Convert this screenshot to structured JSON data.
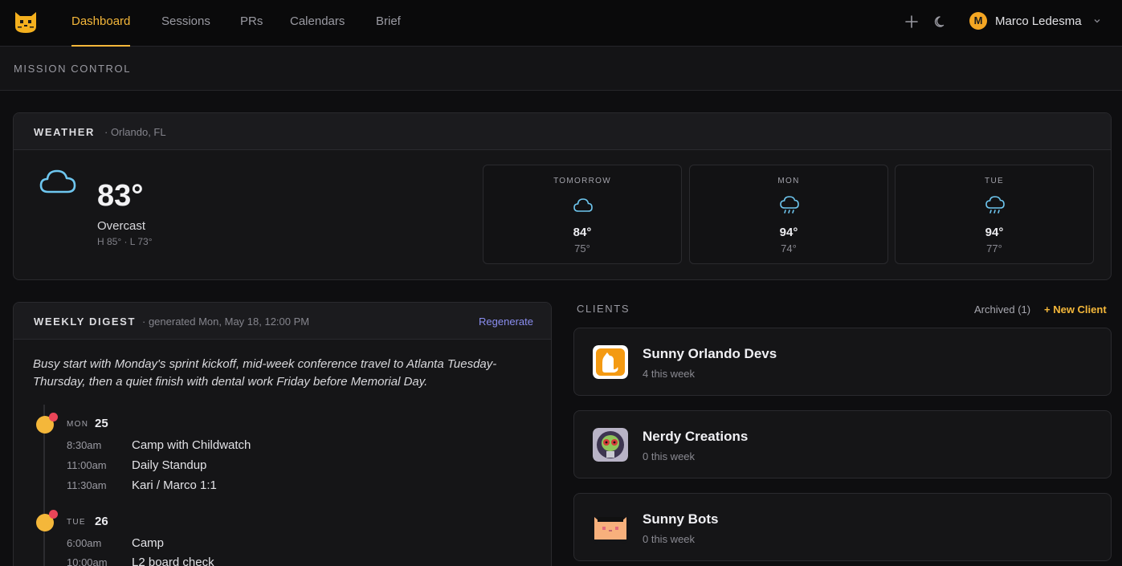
{
  "nav": {
    "tabs": [
      {
        "label": "Dashboard",
        "active": true
      },
      {
        "label": "Sessions",
        "active": false
      },
      {
        "label": "PRs",
        "active": false
      },
      {
        "label": "Calendars",
        "active": false
      },
      {
        "label": "Brief",
        "active": false
      }
    ],
    "icons": [
      "plus-icon",
      "moon-icon",
      "chevron-down-icon"
    ],
    "user": {
      "initial": "M",
      "name": "Marco Ledesma"
    }
  },
  "page": {
    "title": "MISSION CONTROL"
  },
  "weather": {
    "title": "WEATHER",
    "location": "· Orlando, FL",
    "current": {
      "temp": "83°",
      "condition": "Overcast",
      "hilo": "H 85° · L 73°",
      "icon": "cloud-icon"
    },
    "forecast": [
      {
        "day": "TOMORROW",
        "hi": "84°",
        "lo": "75°",
        "icon": "cloud-icon"
      },
      {
        "day": "MON",
        "hi": "94°",
        "lo": "74°",
        "icon": "cloud-rain-icon"
      },
      {
        "day": "TUE",
        "hi": "94°",
        "lo": "77°",
        "icon": "cloud-rain-icon"
      }
    ]
  },
  "digest": {
    "title": "WEEKLY DIGEST",
    "generated": "· generated Mon, May 18, 12:00 PM",
    "regenerate": "Regenerate",
    "summary": "Busy start with Monday's sprint kickoff, mid-week conference travel to Atlanta Tuesday-Thursday, then a quiet finish with dental work Friday before Memorial Day.",
    "days": [
      {
        "dow": "MON",
        "num": "25",
        "events": [
          {
            "time": "8:30am",
            "title": "Camp with Childwatch"
          },
          {
            "time": "11:00am",
            "title": "Daily Standup"
          },
          {
            "time": "11:30am",
            "title": "Kari / Marco 1:1"
          }
        ]
      },
      {
        "dow": "TUE",
        "num": "26",
        "events": [
          {
            "time": "6:00am",
            "title": "Camp"
          },
          {
            "time": "10:00am",
            "title": "L2 board check"
          }
        ]
      }
    ]
  },
  "clients": {
    "title": "CLIENTS",
    "archived": "Archived (1)",
    "new_client": "+ New Client",
    "items": [
      {
        "name": "Sunny Orlando Devs",
        "count": "4 this week"
      },
      {
        "name": "Nerdy Creations",
        "count": "0 this week"
      },
      {
        "name": "Sunny Bots",
        "count": "0 this week"
      }
    ]
  },
  "colors": {
    "accent": "#f4b73a",
    "link": "#8a8ef0",
    "badge": "#ea4558",
    "weather_icon": "#6ec6ef"
  }
}
